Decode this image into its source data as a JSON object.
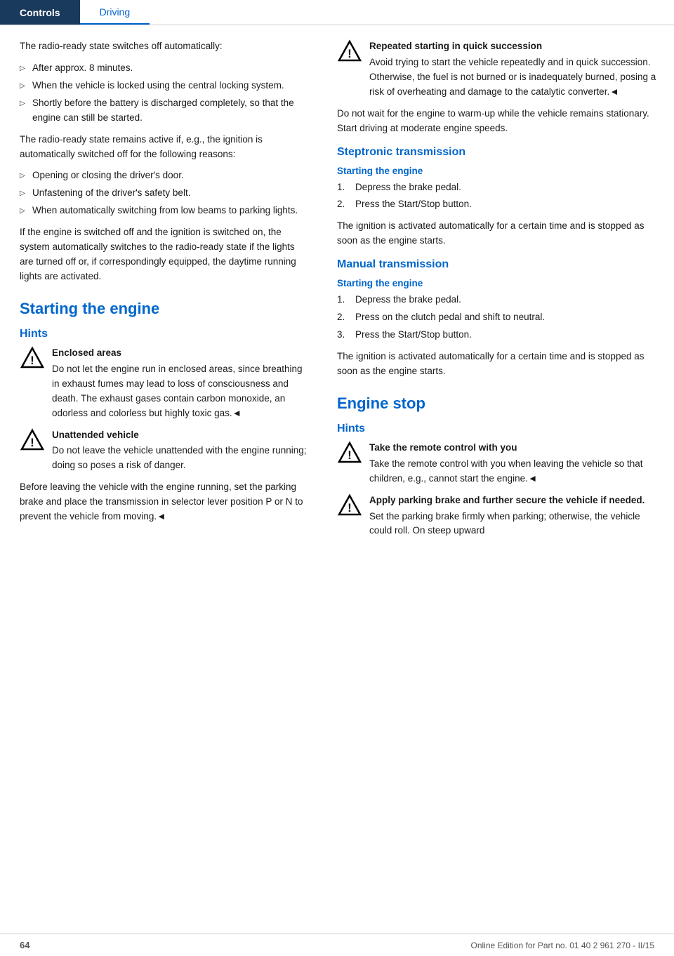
{
  "nav": {
    "tab_controls": "Controls",
    "tab_driving": "Driving"
  },
  "left": {
    "intro_p1": "The radio-ready state switches off automatically:",
    "bullets1": [
      "After approx. 8 minutes.",
      "When the vehicle is locked using the central locking system.",
      "Shortly before the battery is discharged completely, so that the engine can still be started."
    ],
    "intro_p2": "The radio-ready state remains active if, e.g., the ignition is automatically switched off for the following reasons:",
    "bullets2": [
      "Opening or closing the driver's door.",
      "Unfastening of the driver's safety belt.",
      "When automatically switching from low beams to parking lights."
    ],
    "intro_p3": "If the engine is switched off and the ignition is switched on, the system automatically switches to the radio-ready state if the lights are turned off or, if correspondingly equipped, the daytime running lights are activated.",
    "section_starting_engine": "Starting the engine",
    "hints_label": "Hints",
    "warning1_title": "Enclosed areas",
    "warning1_body": "Do not let the engine run in enclosed areas, since breathing in exhaust fumes may lead to loss of consciousness and death. The exhaust gases contain carbon monoxide, an odorless and colorless but highly toxic gas.◄",
    "warning2_title": "Unattended vehicle",
    "warning2_body": "Do not leave the vehicle unattended with the engine running; doing so poses a risk of danger.",
    "before_leaving_p": "Before leaving the vehicle with the engine running, set the parking brake and place the transmission in selector lever position P or N to prevent the vehicle from moving.◄"
  },
  "right": {
    "warning_repeated_title": "Repeated starting in quick succession",
    "warning_repeated_body": "Avoid trying to start the vehicle repeatedly and in quick succession. Otherwise, the fuel is not burned or is inadequately burned, posing a risk of overheating and damage to the catalytic converter.◄",
    "warm_up_p": "Do not wait for the engine to warm-up while the vehicle remains stationary. Start driving at moderate engine speeds.",
    "section_steptronic": "Steptronic transmission",
    "sub_starting1": "Starting the engine",
    "steptronic_steps": [
      "Depress the brake pedal.",
      "Press the Start/Stop button."
    ],
    "steptronic_note": "The ignition is activated automatically for a certain time and is stopped as soon as the engine starts.",
    "section_manual": "Manual transmission",
    "sub_starting2": "Starting the engine",
    "manual_steps": [
      "Depress the brake pedal.",
      "Press on the clutch pedal and shift to neutral.",
      "Press the Start/Stop button."
    ],
    "manual_note": "The ignition is activated automatically for a certain time and is stopped as soon as the engine starts.",
    "section_engine_stop": "Engine stop",
    "hints_label2": "Hints",
    "warning3_title": "Take the remote control with you",
    "warning3_body": "Take the remote control with you when leaving the vehicle so that children, e.g., cannot start the engine.◄",
    "warning4_title": "Apply parking brake and further secure the vehicle if needed.",
    "warning4_body": "Set the parking brake firmly when parking; otherwise, the vehicle could roll. On steep upward"
  },
  "footer": {
    "page_num": "64",
    "copyright": "Online Edition for Part no. 01 40 2 961 270 - II/15"
  }
}
